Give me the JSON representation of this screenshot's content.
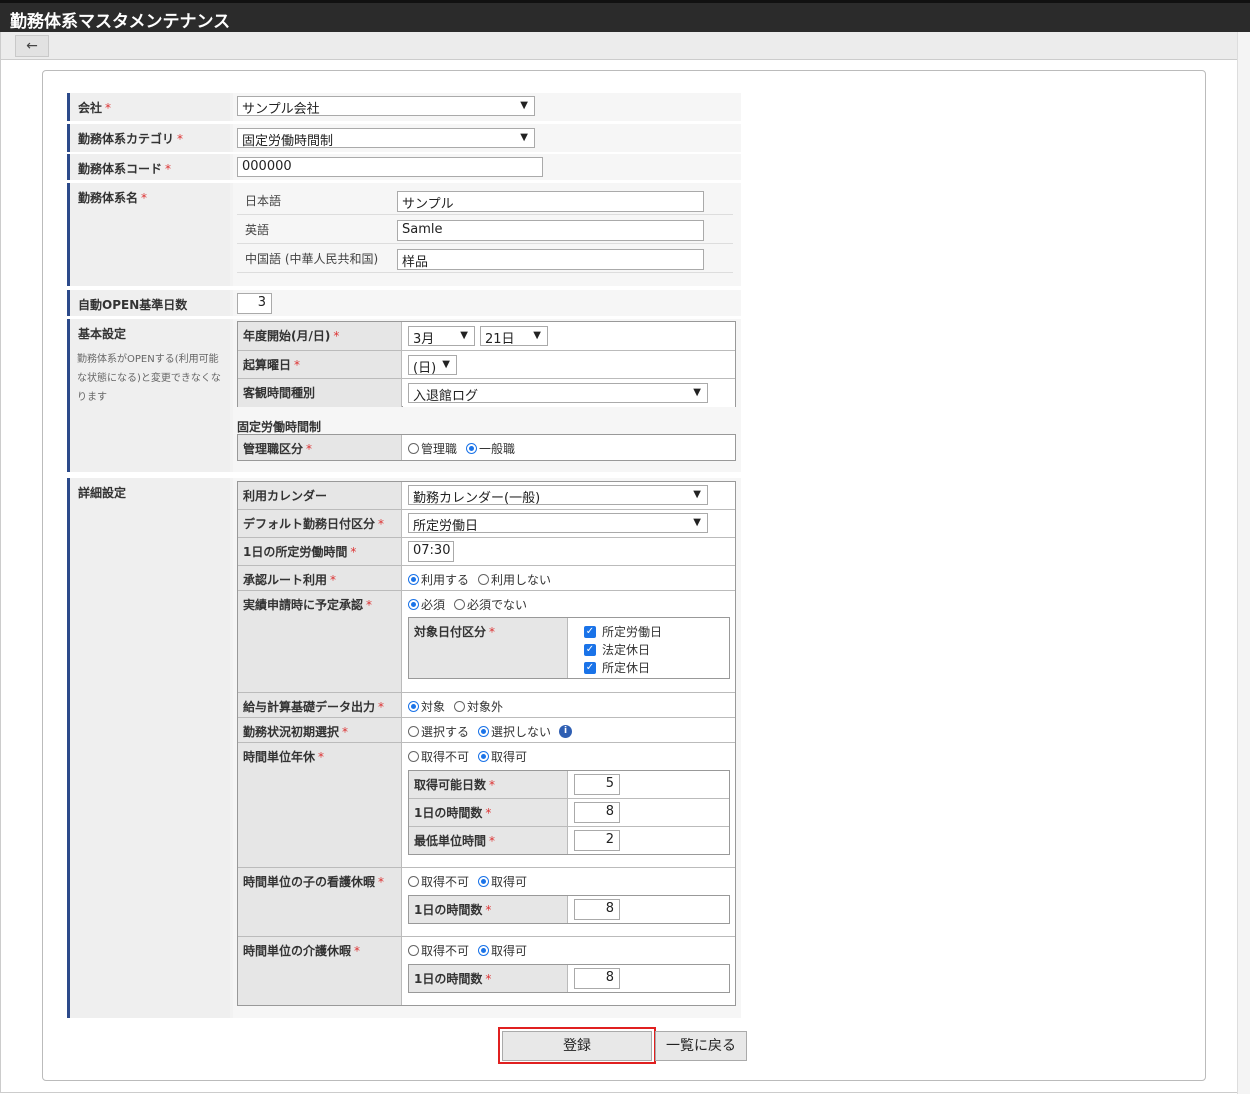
{
  "window": {
    "title": "勤務体系マスタメンテナンス"
  },
  "toolbar": {
    "back_icon": "←"
  },
  "form": {
    "company": {
      "label": "会社",
      "req": "*",
      "value": "サンプル会社"
    },
    "category": {
      "label": "勤務体系カテゴリ",
      "req": "*",
      "value": "固定労働時間制"
    },
    "code": {
      "label": "勤務体系コード",
      "req": "*",
      "value": "000000"
    },
    "name": {
      "label": "勤務体系名",
      "req": "*",
      "ja_label": "日本語",
      "ja_value": "サンプル",
      "en_label": "英語",
      "en_value": "Samle",
      "zh_label": "中国語 (中華人民共和国)",
      "zh_value": "样品"
    },
    "auto_open": {
      "label": "自動OPEN基準日数",
      "value": "3"
    },
    "basic": {
      "label": "基本設定",
      "note1": "勤務体系がOPENする(利用可能",
      "note2": "な状態になる)と変更できなくな",
      "note3": "ります",
      "year_start": {
        "label": "年度開始(月/日)",
        "req": "*",
        "month": "3月",
        "day": "21日"
      },
      "week_start": {
        "label": "起算曜日",
        "req": "*",
        "value": "(日)"
      },
      "objective_time": {
        "label": "客観時間種別",
        "value": "入退館ログ"
      },
      "fixed_heading": "固定労働時間制",
      "mgmt": {
        "label": "管理職区分",
        "req": "*",
        "opt1": "管理職",
        "opt2": "一般職"
      }
    },
    "detail": {
      "label": "詳細設定",
      "calendar": {
        "label": "利用カレンダー",
        "value": "勤務カレンダー(一般)"
      },
      "default_date": {
        "label": "デフォルト勤務日付区分",
        "req": "*",
        "value": "所定労働日"
      },
      "daily_hours": {
        "label": "1日の所定労働時間",
        "req": "*",
        "value": "07:30"
      },
      "approval_route": {
        "label": "承認ルート利用",
        "req": "*",
        "opt1": "利用する",
        "opt2": "利用しない"
      },
      "pre_approval": {
        "label": "実績申請時に予定承認",
        "req": "*",
        "opt1": "必須",
        "opt2": "必須でない",
        "target_label": "対象日付区分",
        "target_req": "*",
        "check1": "所定労働日",
        "check2": "法定休日",
        "check3": "所定休日"
      },
      "payroll": {
        "label": "給与計算基礎データ出力",
        "req": "*",
        "opt1": "対象",
        "opt2": "対象外"
      },
      "status_select": {
        "label": "勤務状況初期選択",
        "req": "*",
        "opt1": "選択する",
        "opt2": "選択しない",
        "info_icon": "i"
      },
      "hourly_leave": {
        "label": "時間単位年休",
        "req": "*",
        "opt1": "取得不可",
        "opt2": "取得可",
        "days_label": "取得可能日数",
        "days_value": "5",
        "hours_label": "1日の時間数",
        "hours_value": "8",
        "min_label": "最低単位時間",
        "min_value": "2"
      },
      "child_care": {
        "label": "時間単位の子の看護休暇",
        "req": "*",
        "opt1": "取得不可",
        "opt2": "取得可",
        "hours_label": "1日の時間数",
        "hours_value": "8"
      },
      "nursing_care": {
        "label": "時間単位の介護休暇",
        "req": "*",
        "opt1": "取得不可",
        "opt2": "取得可",
        "hours_label": "1日の時間数",
        "hours_value": "8"
      }
    }
  },
  "buttons": {
    "register": "登録",
    "back_to_list": "一覧に戻る"
  },
  "colors": {
    "accent": "#2c4a8a",
    "highlight": "#e02020",
    "radio": "#1a73e8"
  }
}
